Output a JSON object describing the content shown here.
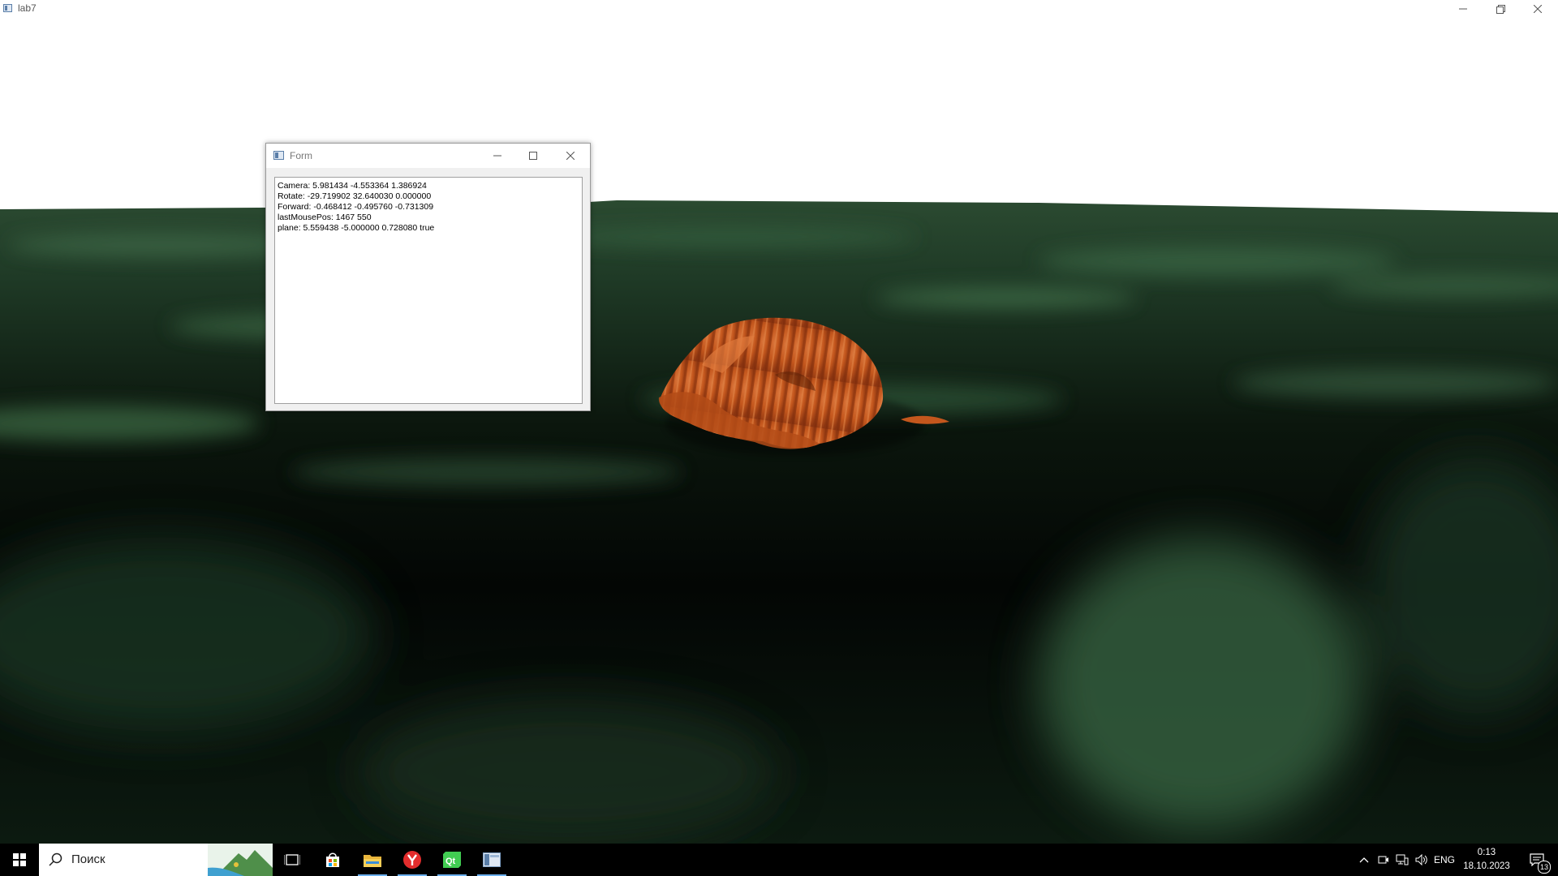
{
  "window": {
    "title": "lab7"
  },
  "form": {
    "title": "Form",
    "lines": [
      "Camera: 5.981434 -4.553364 1.386924",
      "Rotate: -29.719902 32.640030 0.000000",
      "Forward: -0.468412 -0.495760 -0.731309",
      "lastMousePos: 1467 550",
      "plane: 5.559438 -5.000000 0.728080 true"
    ]
  },
  "taskbar": {
    "search_placeholder": "Поиск",
    "pinned": [
      {
        "name": "task-view-icon",
        "active": false
      },
      {
        "name": "store-icon",
        "active": false
      },
      {
        "name": "file-explorer-icon",
        "active": true
      },
      {
        "name": "yandex-browser-icon",
        "active": true
      },
      {
        "name": "qt-creator-icon",
        "active": true
      },
      {
        "name": "lab7-app-icon",
        "active": true
      }
    ],
    "language": "ENG",
    "time": "0:13",
    "date": "18.10.2023",
    "notification_count": "13"
  },
  "colors": {
    "ground_dark": "#030604",
    "ground_green": "#3d6e49",
    "object_orange": "#c4571d",
    "taskbar_accent": "#6cb0ee"
  }
}
